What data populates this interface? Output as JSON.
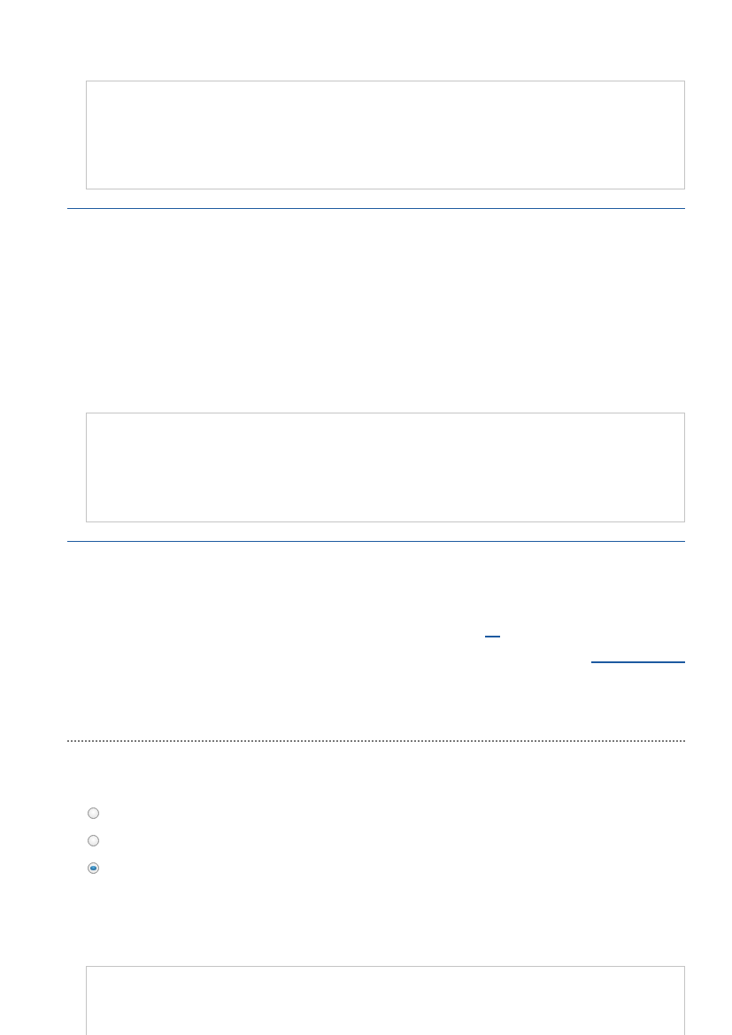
{
  "options": [
    {
      "selected": false
    },
    {
      "selected": false
    },
    {
      "selected": true
    }
  ]
}
